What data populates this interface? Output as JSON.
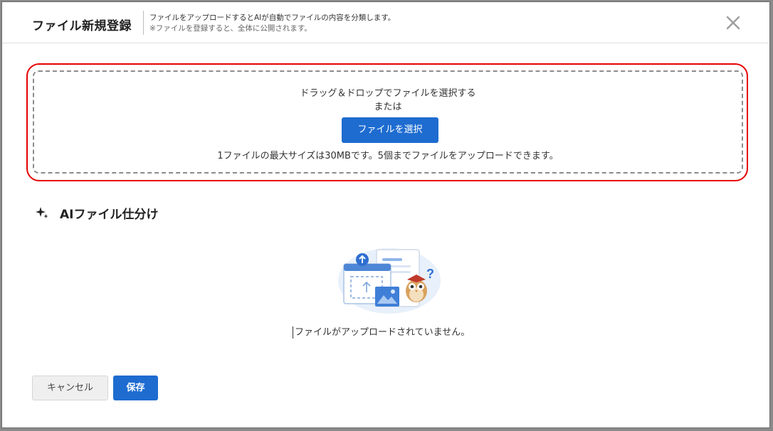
{
  "modal": {
    "title": "ファイル新規登録",
    "description": "ファイルをアップロードするとAIが自動でファイルの内容を分類します。",
    "note": "※ファイルを登録すると、全体に公開されます。",
    "close_icon": "close-icon"
  },
  "dropzone": {
    "instruction": "ドラッグ＆ドロップでファイルを選択する",
    "or": "または",
    "select_button": "ファイルを選択",
    "limit": "1ファイルの最大サイズは30MBです。5個までファイルをアップロードできます。"
  },
  "ai_section": {
    "icon": "sparkle-icon",
    "heading": "AIファイル仕分け",
    "empty_message": "ファイルがアップロードされていません。"
  },
  "footer": {
    "cancel": "キャンセル",
    "save": "保存"
  },
  "colors": {
    "primary": "#1e6cd0",
    "highlight": "#e60000"
  }
}
